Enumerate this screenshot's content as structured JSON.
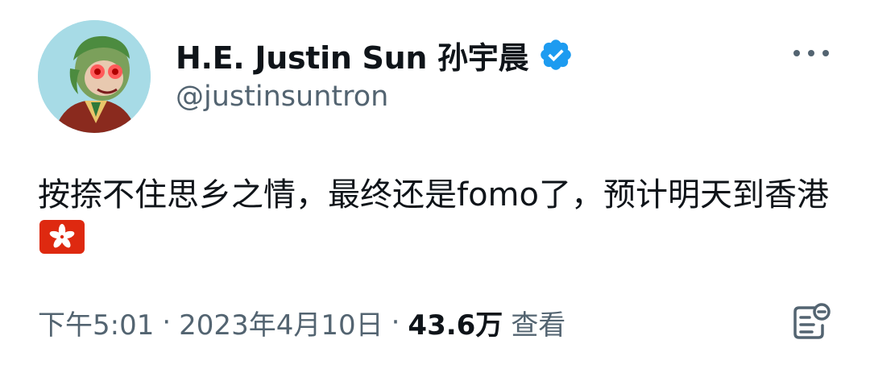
{
  "author": {
    "display_name": "H.E. Justin Sun 孙宇晨",
    "handle": "@justinsuntron",
    "verified": true,
    "verified_badge_color": "#1d9bf0"
  },
  "tweet": {
    "text": "按捺不住思乡之情，最终还是fomo了，预计明天到香港",
    "emoji": "hong-kong-flag"
  },
  "meta": {
    "time": "下午5:01",
    "separator": "·",
    "date": "2023年4月10日",
    "views_count": "43.6万",
    "views_label": "查看"
  },
  "icons": {
    "more": "more-options-icon",
    "notes": "notes-icon",
    "verified": "verified-badge-icon"
  },
  "colors": {
    "text_primary": "#0f1419",
    "text_secondary": "#536471",
    "accent": "#1d9bf0",
    "flag_red": "#de2910"
  }
}
